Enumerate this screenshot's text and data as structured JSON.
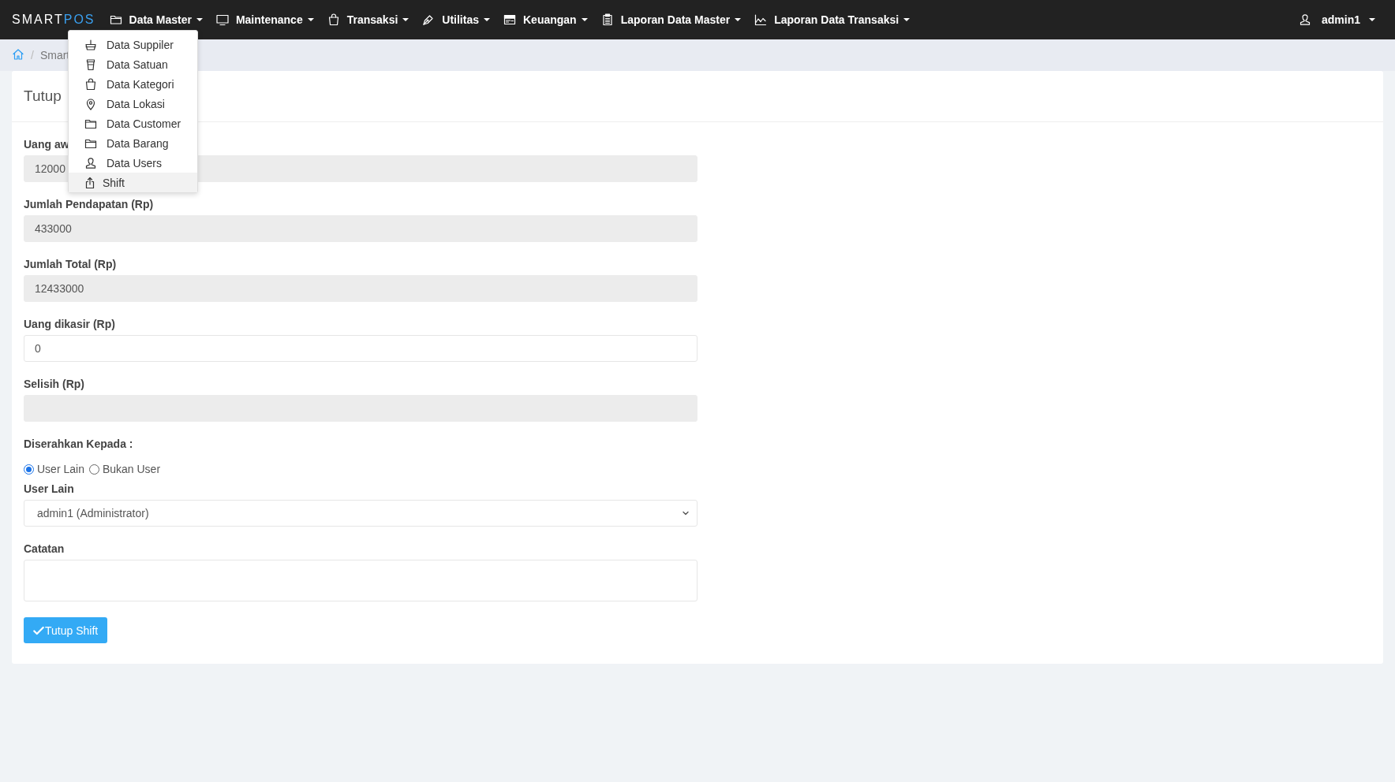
{
  "brand": {
    "text": "SMART",
    "accent": "POS"
  },
  "nav": [
    {
      "label": "Data Master"
    },
    {
      "label": "Maintenance"
    },
    {
      "label": "Transaksi"
    },
    {
      "label": "Utilitas"
    },
    {
      "label": "Keuangan"
    },
    {
      "label": "Laporan Data Master"
    },
    {
      "label": "Laporan Data Transaksi"
    }
  ],
  "user": {
    "label": "admin1"
  },
  "breadcrumb": {
    "separator": "/",
    "text": "Smart"
  },
  "dropdown": {
    "items": [
      {
        "label": "Data Suppiler",
        "selected": false
      },
      {
        "label": "Data Satuan",
        "selected": false
      },
      {
        "label": "Data Kategori",
        "selected": false
      },
      {
        "label": "Data Lokasi",
        "selected": false
      },
      {
        "label": "Data Customer",
        "selected": false
      },
      {
        "label": "Data Barang",
        "selected": false
      },
      {
        "label": "Data Users",
        "selected": false
      },
      {
        "label": "Shift",
        "selected": true
      }
    ]
  },
  "card": {
    "title": "Tutup",
    "fields": [
      {
        "label": "Uang aw",
        "value": "12000",
        "readonly": true
      },
      {
        "label": "Jumlah Pendapatan (Rp)",
        "value": "433000",
        "readonly": true
      },
      {
        "label": "Jumlah Total (Rp)",
        "value": "12433000",
        "readonly": true
      },
      {
        "label": "Uang dikasir (Rp)",
        "value": "0",
        "readonly": false
      },
      {
        "label": "Selisih (Rp)",
        "readonly": true
      }
    ],
    "handover": {
      "label": "Diserahkan Kepada :",
      "options": [
        {
          "label": "User Lain",
          "selected": true
        },
        {
          "label": "Bukan User",
          "selected": false
        }
      ]
    },
    "user_select": {
      "label": "User Lain",
      "value": "admin1 (Administrator)"
    },
    "notes": {
      "label": "Catatan"
    },
    "submit": {
      "label": "Tutup Shift"
    }
  }
}
